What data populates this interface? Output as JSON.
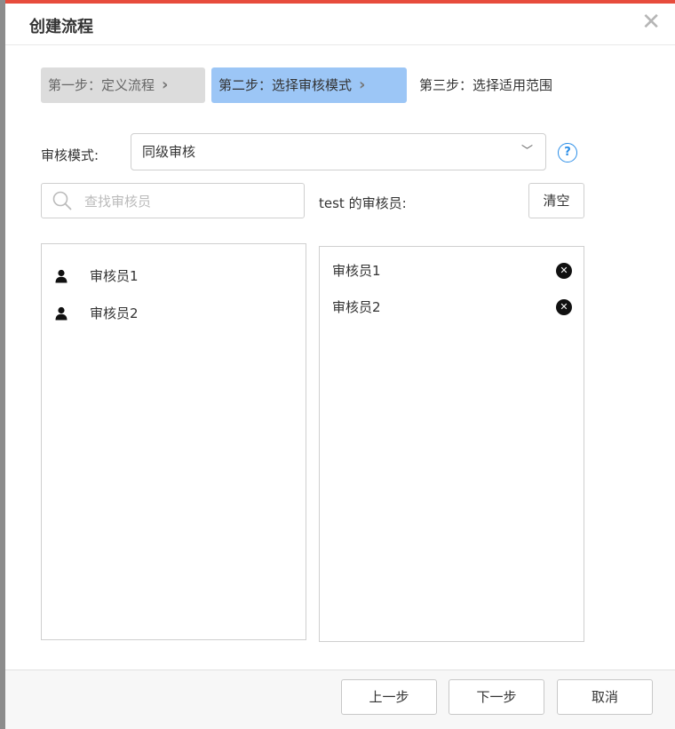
{
  "dialog": {
    "title": "创建流程",
    "close_icon": "close-icon"
  },
  "steps": [
    {
      "label": "第一步：定义流程",
      "state": "done"
    },
    {
      "label": "第二步：选择审核模式",
      "state": "active"
    },
    {
      "label": "第三步：选择适用范围",
      "state": "pending"
    }
  ],
  "mode": {
    "label": "审核模式:",
    "selected": "同级审核",
    "help_icon": "question-circle-icon"
  },
  "search": {
    "placeholder": "查找审核员",
    "value": ""
  },
  "selected_panel": {
    "label": "test 的审核员:",
    "clear_label": "清空"
  },
  "available_reviewers": [
    {
      "name": "审核员1"
    },
    {
      "name": "审核员2"
    }
  ],
  "selected_reviewers": [
    {
      "name": "审核员1"
    },
    {
      "name": "审核员2"
    }
  ],
  "footer": {
    "prev_label": "上一步",
    "next_label": "下一步",
    "cancel_label": "取消"
  },
  "colors": {
    "accent_top": "#e74c3c",
    "active_step": "#9cc6f6",
    "done_step": "#dcdcdc",
    "help_blue": "#2b8ee8"
  }
}
